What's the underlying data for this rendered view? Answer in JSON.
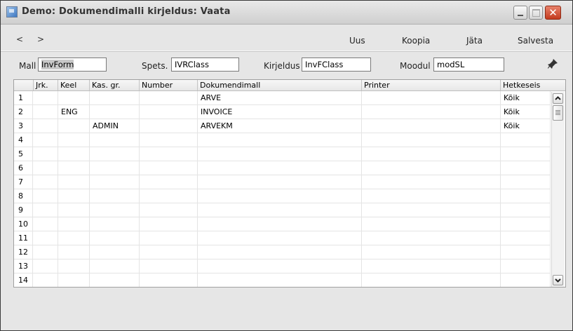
{
  "window": {
    "title": "Demo: Dokumendimalli kirjeldus: Vaata"
  },
  "toolbar": {
    "prev": "<",
    "next": ">",
    "new_label": "Uus",
    "copy_label": "Koopia",
    "leave_label": "Jäta",
    "save_label": "Salvesta"
  },
  "fields": {
    "mall_label": "Mall",
    "mall_value_sel": "InvForm",
    "mall_value_rest": "",
    "spets_label": "Spets.",
    "spets_value": "IVRClass",
    "kirjeldus_label": "Kirjeldus",
    "kirjeldus_value": "InvFClass",
    "moodul_label": "Moodul",
    "moodul_value": "modSL",
    "pin_icon": "pin-icon"
  },
  "table": {
    "columns": [
      "Jrk.",
      "Keel",
      "Kas. gr.",
      "Number",
      "Dokumendimall",
      "Printer",
      "Hetkeseis"
    ],
    "rows": [
      {
        "n": "1",
        "jrk": "",
        "keel": "",
        "kasgr": "",
        "number": "",
        "mall": "ARVE",
        "printer": "",
        "hetkeseis": "Kõik"
      },
      {
        "n": "2",
        "jrk": "",
        "keel": "ENG",
        "kasgr": "",
        "number": "",
        "mall": "INVOICE",
        "printer": "",
        "hetkeseis": "Kõik"
      },
      {
        "n": "3",
        "jrk": "",
        "keel": "",
        "kasgr": "ADMIN",
        "number": "",
        "mall": "ARVEKM",
        "printer": "",
        "hetkeseis": "Kõik"
      },
      {
        "n": "4",
        "jrk": "",
        "keel": "",
        "kasgr": "",
        "number": "",
        "mall": "",
        "printer": "",
        "hetkeseis": ""
      },
      {
        "n": "5",
        "jrk": "",
        "keel": "",
        "kasgr": "",
        "number": "",
        "mall": "",
        "printer": "",
        "hetkeseis": ""
      },
      {
        "n": "6",
        "jrk": "",
        "keel": "",
        "kasgr": "",
        "number": "",
        "mall": "",
        "printer": "",
        "hetkeseis": ""
      },
      {
        "n": "7",
        "jrk": "",
        "keel": "",
        "kasgr": "",
        "number": "",
        "mall": "",
        "printer": "",
        "hetkeseis": ""
      },
      {
        "n": "8",
        "jrk": "",
        "keel": "",
        "kasgr": "",
        "number": "",
        "mall": "",
        "printer": "",
        "hetkeseis": ""
      },
      {
        "n": "9",
        "jrk": "",
        "keel": "",
        "kasgr": "",
        "number": "",
        "mall": "",
        "printer": "",
        "hetkeseis": ""
      },
      {
        "n": "10",
        "jrk": "",
        "keel": "",
        "kasgr": "",
        "number": "",
        "mall": "",
        "printer": "",
        "hetkeseis": ""
      },
      {
        "n": "11",
        "jrk": "",
        "keel": "",
        "kasgr": "",
        "number": "",
        "mall": "",
        "printer": "",
        "hetkeseis": ""
      },
      {
        "n": "12",
        "jrk": "",
        "keel": "",
        "kasgr": "",
        "number": "",
        "mall": "",
        "printer": "",
        "hetkeseis": ""
      },
      {
        "n": "13",
        "jrk": "",
        "keel": "",
        "kasgr": "",
        "number": "",
        "mall": "",
        "printer": "",
        "hetkeseis": ""
      },
      {
        "n": "14",
        "jrk": "",
        "keel": "",
        "kasgr": "",
        "number": "",
        "mall": "",
        "printer": "",
        "hetkeseis": ""
      }
    ]
  },
  "colors": {
    "title_text": "#333333",
    "close_button": "#c33a1e",
    "grid_bg": "#ffffff"
  }
}
